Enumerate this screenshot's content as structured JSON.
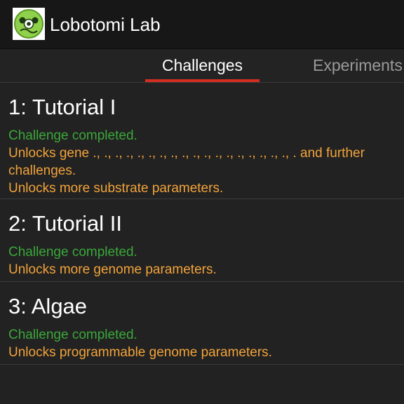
{
  "app": {
    "title": "Lobotomi Lab",
    "icon": "green-blob-logo-icon"
  },
  "tabs": [
    {
      "label": "Challenges",
      "active": true
    },
    {
      "label": "Experiments",
      "active": false
    }
  ],
  "challenges": [
    {
      "title": "1: Tutorial I",
      "status": "Challenge completed.",
      "unlocks": [
        "Unlocks gene ., ., ., ., ., ., ., ., ., ., ., ., ., ., ., ., ., ., . and further challenges.",
        "Unlocks more substrate parameters."
      ]
    },
    {
      "title": "2: Tutorial II",
      "status": "Challenge completed.",
      "unlocks": [
        "Unlocks more genome parameters."
      ]
    },
    {
      "title": "3: Algae",
      "status": "Challenge completed.",
      "unlocks": [
        "Unlocks programmable genome parameters."
      ]
    }
  ],
  "colors": {
    "status": "#3aa83a",
    "unlock": "#f2a33a",
    "tab_indicator": "#d62d20",
    "action_bar": "#171717",
    "background": "#222222"
  }
}
